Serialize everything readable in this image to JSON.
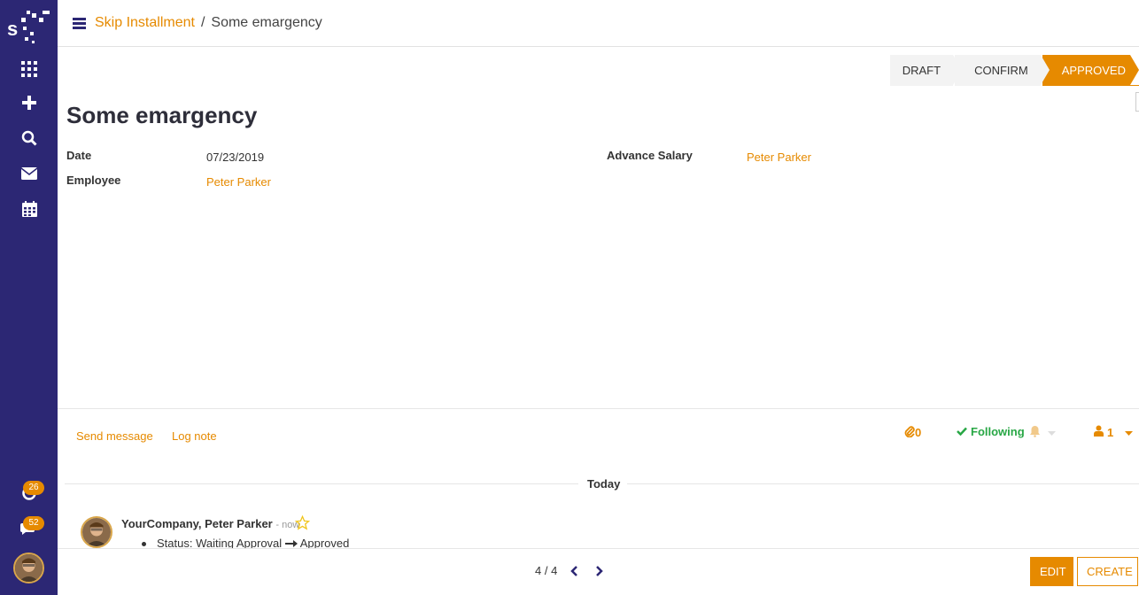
{
  "sidebar": {
    "logo_letter": "s",
    "icons": [
      "apps-grid-icon",
      "plus-icon",
      "search-icon",
      "envelope-icon",
      "calendar-icon"
    ],
    "activity_badge": "26",
    "messages_badge": "52"
  },
  "breadcrumb": {
    "parent": "Skip Installment",
    "separator": "/",
    "current": "Some emargency"
  },
  "status_stages": [
    {
      "label": "DRAFT",
      "active": false
    },
    {
      "label": "CONFIRM",
      "active": false
    },
    {
      "label": "APPROVED",
      "active": true
    }
  ],
  "record": {
    "title": "Some emargency",
    "date_label": "Date",
    "date_value": "07/23/2019",
    "employee_label": "Employee",
    "employee_value": "Peter Parker",
    "advance_label": "Advance Salary",
    "advance_value": "Peter Parker"
  },
  "chatter": {
    "send_message": "Send message",
    "log_note": "Log note",
    "attachments_count": "0",
    "following_label": "Following",
    "followers_count": "1",
    "day_separator": "Today",
    "message": {
      "author": "YourCompany, Peter Parker",
      "time": "- now",
      "tracking_field": "Status:",
      "old_value": "Waiting Approval",
      "new_value": "Approved"
    }
  },
  "footer": {
    "pager": "4 / 4",
    "edit_label": "EDIT",
    "create_label": "CREATE"
  },
  "colors": {
    "sidebar": "#2c2774",
    "accent": "#e68a00",
    "following": "#28a745"
  }
}
